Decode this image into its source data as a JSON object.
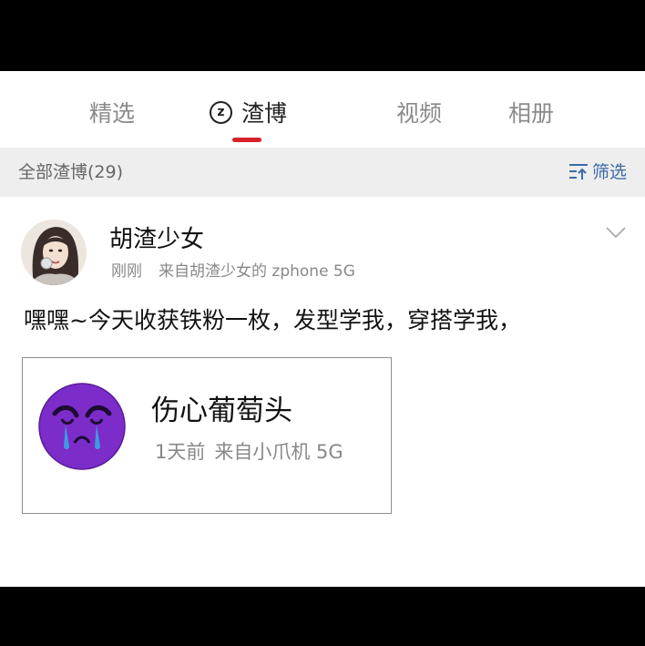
{
  "tabs": [
    {
      "label": "精选",
      "active": false
    },
    {
      "label": "渣博",
      "active": true,
      "icon": "z-circle-icon",
      "icon_glyph": "z"
    },
    {
      "label": "视频",
      "active": false
    },
    {
      "label": "相册",
      "active": false
    }
  ],
  "filter_bar": {
    "title": "全部渣博",
    "count": "(29)",
    "filter_label": "筛选",
    "filter_icon": "filter-icon"
  },
  "post": {
    "user_name": "胡渣少女",
    "time": "刚刚",
    "source": "来自胡渣少女的 zphone 5G",
    "text": "嘿嘿~今天收获铁粉一枚，发型学我，穿搭学我，",
    "menu_icon": "chevron-down-icon",
    "quote": {
      "user_name": "伤心葡萄头",
      "time": "1天前",
      "source": "来自小爪机 5G",
      "avatar_icon": "crying-purple-face-icon"
    }
  },
  "colors": {
    "accent": "#d8222b",
    "link": "#3c6ba8",
    "filter_bg": "#eeeeee",
    "quote_avatar": "#7b2cc9"
  }
}
